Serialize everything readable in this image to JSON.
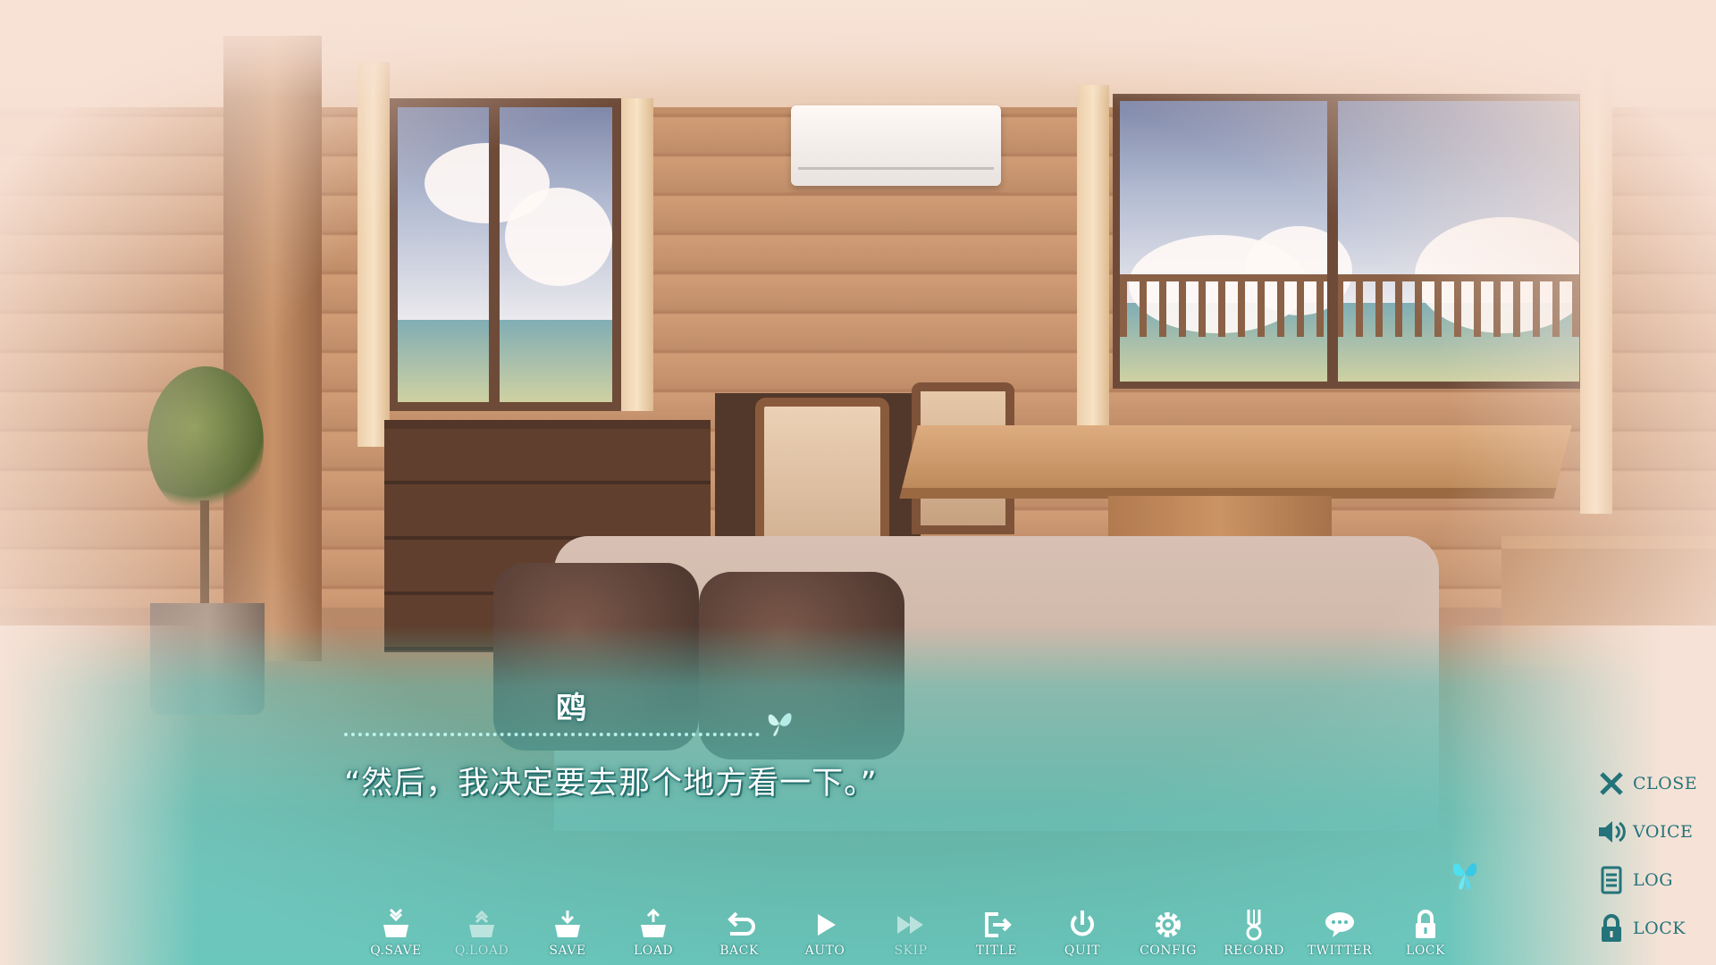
{
  "dialogue": {
    "speaker": "鸥",
    "text": "“然后，我决定要去那个地方看一下。”"
  },
  "bottom_menu": {
    "items": [
      {
        "label": "Q.SAVE",
        "icon": "quick-save-icon"
      },
      {
        "label": "Q.LOAD",
        "icon": "quick-load-icon"
      },
      {
        "label": "SAVE",
        "icon": "save-icon"
      },
      {
        "label": "LOAD",
        "icon": "load-icon"
      },
      {
        "label": "BACK",
        "icon": "back-arrow-icon"
      },
      {
        "label": "AUTO",
        "icon": "play-icon"
      },
      {
        "label": "SKIP",
        "icon": "fast-forward-icon"
      },
      {
        "label": "TITLE",
        "icon": "exit-door-icon"
      },
      {
        "label": "QUIT",
        "icon": "power-icon"
      },
      {
        "label": "CONFIG",
        "icon": "gear-icon"
      },
      {
        "label": "RECORD",
        "icon": "medal-icon"
      },
      {
        "label": "TWITTER",
        "icon": "speech-bubble-icon"
      },
      {
        "label": "LOCK",
        "icon": "padlock-icon"
      }
    ]
  },
  "side_menu": {
    "items": [
      {
        "label": "CLOSE",
        "icon": "close-icon"
      },
      {
        "label": "VOICE",
        "icon": "speaker-icon"
      },
      {
        "label": "LOG",
        "icon": "log-list-icon"
      },
      {
        "label": "LOCK",
        "icon": "padlock-icon"
      }
    ]
  },
  "colors": {
    "menu_accent": "#24737a",
    "message_window": "#56beb4",
    "icon_white": "#ffffff"
  }
}
